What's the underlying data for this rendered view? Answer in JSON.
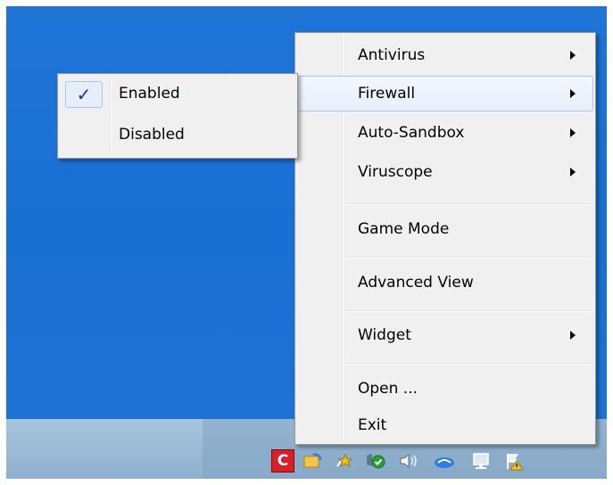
{
  "main_menu": {
    "items": [
      {
        "label": "Antivirus",
        "submenu": true
      },
      {
        "label": "Firewall",
        "submenu": true,
        "highlighted": true
      },
      {
        "label": "Auto-Sandbox",
        "submenu": true
      },
      {
        "label": "Viruscope",
        "submenu": true
      },
      {
        "label": "Game Mode",
        "submenu": false
      },
      {
        "label": "Advanced View",
        "submenu": false
      },
      {
        "label": "Widget",
        "submenu": true
      },
      {
        "label": "Open ...",
        "submenu": false
      },
      {
        "label": "Exit",
        "submenu": false
      }
    ]
  },
  "firewall_submenu": {
    "items": [
      {
        "label": "Enabled",
        "checked": true,
        "check_glyph": "✓"
      },
      {
        "label": "Disabled",
        "checked": false
      }
    ]
  },
  "tray": {
    "icons": [
      "comodo-icon",
      "folder-sync-icon",
      "star-icon",
      "shield-check-icon",
      "speaker-icon",
      "cloud-icon",
      "network-icon",
      "warning-flag-icon"
    ],
    "comodo_letter": "C"
  },
  "colors": {
    "desktop": "#1a6fd2",
    "taskbar": "#9dbbd6",
    "menu_bg": "#f0f0f0",
    "highlight_border": "#a8c8ea",
    "check": "#1b2aa8",
    "comodo_red": "#d8202a"
  }
}
